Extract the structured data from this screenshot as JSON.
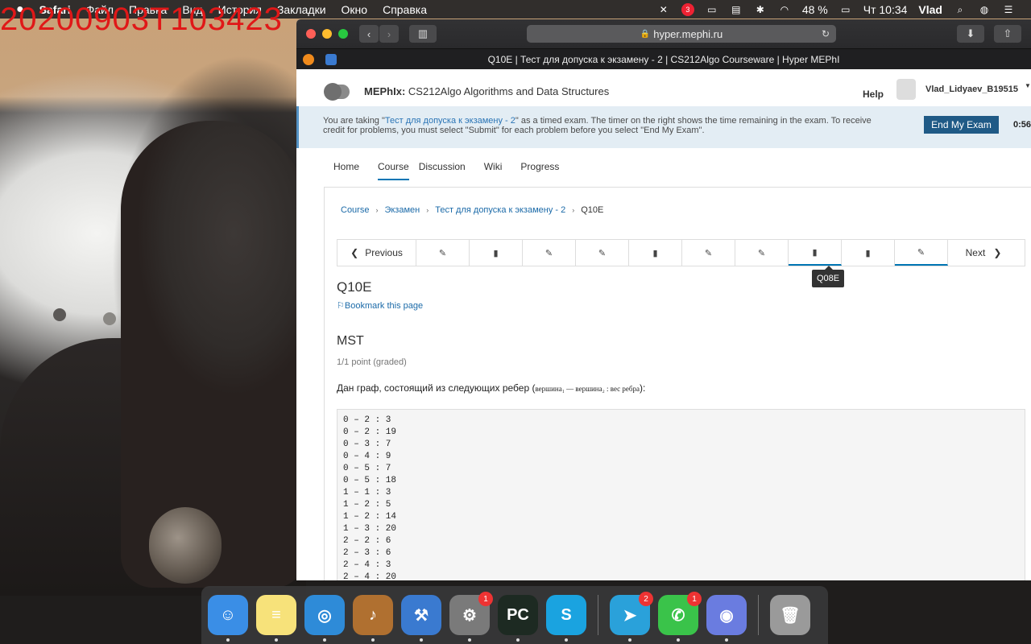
{
  "overlay": {
    "timestamp": "20200903T103423"
  },
  "menubar": {
    "app": "Safari",
    "items": [
      "Файл",
      "Правка",
      "Вид",
      "История",
      "Закладки",
      "Окно",
      "Справка"
    ],
    "battery": "48 %",
    "datetime": "Чт 10:34",
    "user": "Vlad",
    "notification_badge": "3"
  },
  "browser": {
    "address": "hyper.mephi.ru",
    "tab_title": "Q10E | Тест для допуска к экзамену - 2 | CS212Algo Courseware | Hyper MEPhI"
  },
  "header": {
    "org": "MEPhIx:",
    "course": "CS212Algo Algorithms and Data Structures",
    "help": "Help",
    "username": "Vlad_Lidyaev_B19515"
  },
  "banner": {
    "prefix": "You are taking \"",
    "link": "Тест для допуска к экзамену - 2",
    "suffix": "\" as a timed exam. The timer on the right shows the time remaining in the exam. To receive credit for problems, you must select \"Submit\" for each problem before you select \"End My Exam\".",
    "button": "End My Exam",
    "timer": "0:56:"
  },
  "tabs": [
    "Home",
    "Course",
    "Discussion",
    "Wiki",
    "Progress"
  ],
  "breadcrumb": [
    "Course",
    "Экзамен",
    "Тест для допуска к экзамену - 2",
    "Q10E"
  ],
  "sequence": {
    "previous": "Previous",
    "next": "Next",
    "tooltip": "Q08E",
    "units": [
      "problem",
      "book",
      "problem",
      "problem",
      "book",
      "problem",
      "problem",
      "book",
      "book",
      "problem"
    ]
  },
  "unit": {
    "title": "Q10E",
    "bookmark": "Bookmark this page",
    "problem_title": "MST",
    "points": "1/1 point (graded)",
    "question_prefix": "Дан граф, состоящий из следующих ребер (",
    "question_math": "вершина₁ — вершина₂ : вес ребра",
    "question_suffix": "):"
  },
  "edges": [
    "0 – 2 : 3",
    "0 – 2 : 19",
    "0 – 3 : 7",
    "0 – 4 : 9",
    "0 – 5 : 7",
    "0 – 5 : 18",
    "1 – 1 : 3",
    "1 – 2 : 5",
    "1 – 2 : 14",
    "1 – 3 : 20",
    "2 – 2 : 6",
    "2 – 3 : 6",
    "2 – 4 : 3",
    "2 – 4 : 20"
  ],
  "dock": {
    "apps": [
      {
        "name": "Finder",
        "color": "#3a8ee6",
        "glyph": "☺"
      },
      {
        "name": "Notes",
        "color": "#f7e27a",
        "glyph": "≡"
      },
      {
        "name": "Safari",
        "color": "#2e8bd8",
        "glyph": "◎"
      },
      {
        "name": "GarageBand",
        "color": "#b07030",
        "glyph": "♪"
      },
      {
        "name": "Xcode",
        "color": "#3a7ad0",
        "glyph": "⚒"
      },
      {
        "name": "System Preferences",
        "color": "#7a7a7a",
        "glyph": "⚙",
        "badge": "1"
      },
      {
        "name": "PyCharm",
        "color": "#1d2a22",
        "glyph": "PC"
      },
      {
        "name": "Skype",
        "color": "#1aa3e0",
        "glyph": "S"
      },
      {
        "name": "Telegram",
        "color": "#2aa1da",
        "glyph": "➤",
        "badge": "2"
      },
      {
        "name": "FaceTime",
        "color": "#3ac34a",
        "glyph": "✆",
        "badge": "1"
      },
      {
        "name": "Discord",
        "color": "#6a7ce0",
        "glyph": "◉"
      },
      {
        "name": "Trash",
        "color": "#9a9a9a",
        "glyph": "🗑"
      }
    ]
  }
}
